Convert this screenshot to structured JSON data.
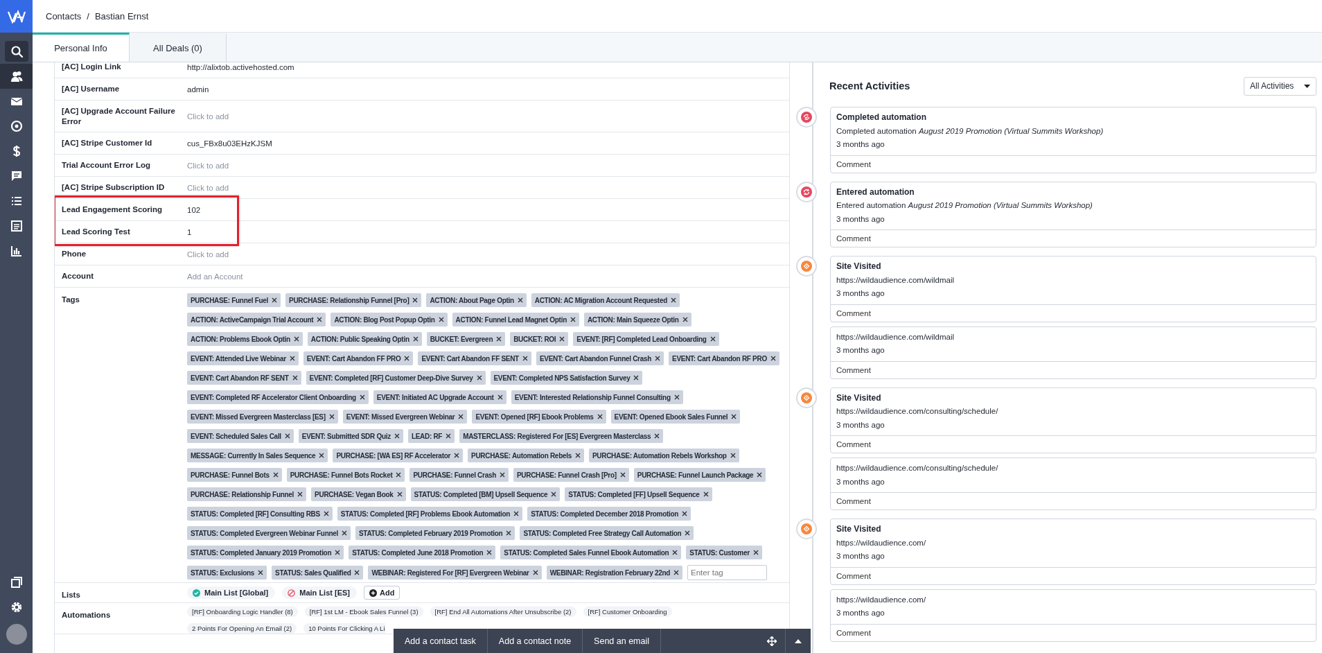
{
  "sidebar": {
    "items": [
      {
        "kind": "search",
        "selected": false
      },
      {
        "kind": "contacts",
        "selected": true
      },
      {
        "kind": "mail",
        "selected": false
      },
      {
        "kind": "target",
        "selected": false
      },
      {
        "kind": "dollar",
        "selected": false
      },
      {
        "kind": "chat",
        "selected": false
      },
      {
        "kind": "list",
        "selected": false
      },
      {
        "kind": "document",
        "selected": false
      },
      {
        "kind": "chart",
        "selected": false
      }
    ],
    "bottom_items": [
      {
        "kind": "windows"
      },
      {
        "kind": "settings"
      },
      {
        "kind": "avatar"
      }
    ]
  },
  "breadcrumb": {
    "items": [
      "Contacts",
      "Bastian Ernst"
    ],
    "separator": "/"
  },
  "tabs": [
    {
      "label": "Personal Info",
      "selected": true
    },
    {
      "label": "All Deals (0)",
      "selected": false
    }
  ],
  "fields": [
    {
      "label": "[AC] Login Link",
      "value": "http://alixtob.activehosted.com",
      "highlighted": false
    },
    {
      "label": "[AC] Username",
      "value": "admin",
      "highlighted": false
    },
    {
      "label": "[AC] Upgrade Account Failure Error",
      "placeholder": "Click to add",
      "highlighted": false
    },
    {
      "label": "[AC] Stripe Customer Id",
      "value": "cus_FBx8u03EHzKJSM",
      "highlighted": false
    },
    {
      "label": "Trial Account Error Log",
      "placeholder": "Click to add",
      "highlighted": false
    },
    {
      "label": "[AC] Stripe Subscription ID",
      "placeholder": "Click to add",
      "highlighted": false
    },
    {
      "label": "Lead Engagement Scoring",
      "value": "102",
      "highlighted": true
    },
    {
      "label": "Lead Scoring Test",
      "value": "1",
      "highlighted": true
    },
    {
      "label": "Phone",
      "placeholder": "Click to add",
      "highlighted": false
    },
    {
      "label": "Account",
      "placeholder": "Add an Account",
      "highlighted": false
    }
  ],
  "tags": {
    "label": "Tags",
    "items": [
      "PURCHASE: Funnel Fuel",
      "PURCHASE: Relationship Funnel [Pro]",
      "ACTION: About Page Optin",
      "ACTION: AC Migration Account Requested",
      "ACTION: ActiveCampaign Trial Account",
      "ACTION: Blog Post Popup Optin",
      "ACTION: Funnel Lead Magnet Optin",
      "ACTION: Main Squeeze Optin",
      "ACTION: Problems Ebook Optin",
      "ACTION: Public Speaking Optin",
      "BUCKET: Evergreen",
      "BUCKET: ROI",
      "EVENT: [RF] Completed Lead Onboarding",
      "EVENT: Attended Live Webinar",
      "EVENT: Cart Abandon FF PRO",
      "EVENT: Cart Abandon FF SENT",
      "EVENT: Cart Abandon Funnel Crash",
      "EVENT: Cart Abandon RF PRO",
      "EVENT: Cart Abandon RF SENT",
      "EVENT: Completed [RF] Customer Deep-Dive Survey",
      "EVENT: Completed NPS Satisfaction Survey",
      "EVENT: Completed RF Accelerator Client Onboarding",
      "EVENT: Initiated AC Upgrade Account",
      "EVENT: Interested Relationship Funnel Consulting",
      "EVENT: Missed Evergreen Masterclass [ES]",
      "EVENT: Missed Evergreen Webinar",
      "EVENT: Opened [RF] Ebook Problems",
      "EVENT: Opened Ebook Sales Funnel",
      "EVENT: Scheduled Sales Call",
      "EVENT: Submitted SDR Quiz",
      "LEAD: RF",
      "MASTERCLASS: Registered For [ES] Evergreen Masterclass",
      "MESSAGE: Currently In Sales Sequence",
      "PURCHASE: [WA ES] RF Accelerator",
      "PURCHASE: Automation Rebels",
      "PURCHASE: Automation Rebels Workshop",
      "PURCHASE: Funnel Bots",
      "PURCHASE: Funnel Bots Rocket",
      "PURCHASE: Funnel Crash",
      "PURCHASE: Funnel Crash [Pro]",
      "PURCHASE: Funnel Launch Package",
      "PURCHASE: Relationship Funnel",
      "PURCHASE: Vegan Book",
      "STATUS: Completed [BM] Upsell Sequence",
      "STATUS: Completed [FF] Upsell Sequence",
      "STATUS: Completed [RF] Consulting RBS",
      "STATUS: Completed [RF] Problems Ebook Automation",
      "STATUS: Completed December 2018 Promotion",
      "STATUS: Completed Evergreen Webinar Funnel",
      "STATUS: Completed February 2019 Promotion",
      "STATUS: Completed Free Strategy Call Automation",
      "STATUS: Completed January 2019 Promotion",
      "STATUS: Completed June 2018 Promotion",
      "STATUS: Completed Sales Funnel Ebook Automation",
      "STATUS: Customer",
      "STATUS: Exclusions",
      "STATUS: Sales Qualified",
      "WEBINAR: Registered For [RF] Evergreen Webinar",
      "WEBINAR: Registration February 22nd"
    ],
    "input_placeholder": "Enter tag"
  },
  "lists": {
    "label": "Lists",
    "items": [
      {
        "name": "Main List [Global]",
        "subscribed": true
      },
      {
        "name": "Main List [ES]",
        "subscribed": false
      }
    ],
    "add_button": "Add"
  },
  "automations": {
    "label": "Automations",
    "items": [
      "[RF] Onboarding Logic Handler (8)",
      "[RF] 1st LM - Ebook Sales Funnel (3)",
      "[RF] End All Automations After Unsubscribe (2)",
      "[RF] Customer Onboarding",
      "2 Points For Opening An Email (2)",
      "10 Points For Clicking A Li"
    ]
  },
  "activities": {
    "title": "Recent Activities",
    "filter": "All Activities",
    "items": [
      {
        "kind": "automation-completed",
        "title": "Completed automation",
        "text": "Completed automation *August 2019 Promotion (Virtual Summits Workshop)*",
        "time": "3 months ago",
        "comment": "Comment"
      },
      {
        "kind": "automation-entered",
        "title": "Entered automation",
        "text": "Entered automation *August 2019 Promotion (Virtual Summits Workshop)*",
        "time": "3 months ago",
        "comment": "Comment"
      },
      {
        "kind": "site-visit",
        "title": "Site Visited",
        "text": "https://wildaudience.com/wildmail",
        "time": "3 months ago",
        "comment": "Comment"
      },
      {
        "kind": "continuation",
        "text": "https://wildaudience.com/wildmail",
        "time": "3 months ago",
        "comment": "Comment"
      },
      {
        "kind": "site-visit",
        "title": "Site Visited",
        "text": "https://wildaudience.com/consulting/schedule/",
        "time": "3 months ago",
        "comment": "Comment"
      },
      {
        "kind": "continuation",
        "text": "https://wildaudience.com/consulting/schedule/",
        "time": "3 months ago",
        "comment": "Comment"
      },
      {
        "kind": "site-visit",
        "title": "Site Visited",
        "text": "https://wildaudience.com/",
        "time": "3 months ago",
        "comment": "Comment"
      },
      {
        "kind": "continuation",
        "text": "https://wildaudience.com/",
        "time": "3 months ago",
        "comment": "Comment"
      }
    ]
  },
  "action_bar": {
    "items": [
      "Add a contact task",
      "Add a contact note",
      "Send an email"
    ]
  }
}
